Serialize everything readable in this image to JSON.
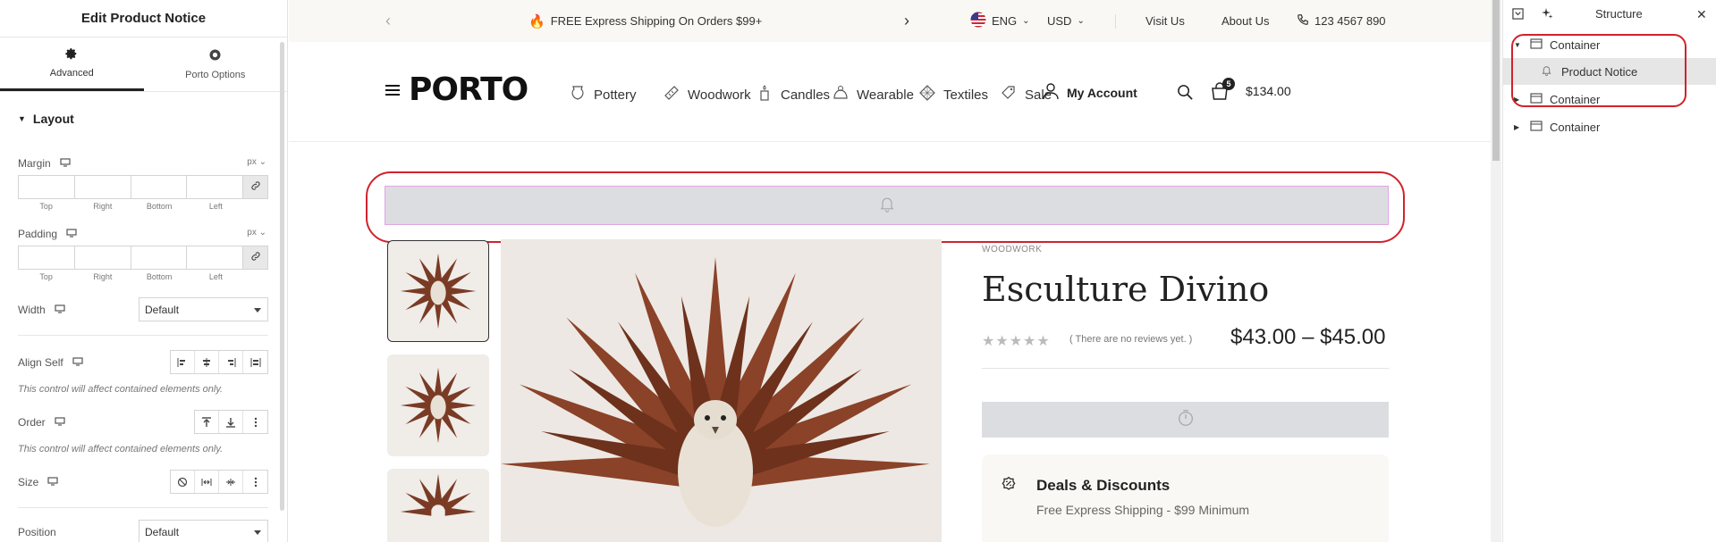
{
  "editor": {
    "title": "Edit Product Notice",
    "tabs": [
      {
        "label": "Advanced"
      },
      {
        "label": "Porto Options"
      }
    ],
    "section_title": "Layout",
    "margin": {
      "label": "Margin",
      "unit": "px",
      "sides": [
        "Top",
        "Right",
        "Bottom",
        "Left"
      ]
    },
    "padding": {
      "label": "Padding",
      "unit": "px",
      "sides": [
        "Top",
        "Right",
        "Bottom",
        "Left"
      ]
    },
    "width": {
      "label": "Width",
      "value": "Default"
    },
    "align_self": {
      "label": "Align Self",
      "note": "This control will affect contained elements only."
    },
    "order": {
      "label": "Order",
      "note": "This control will affect contained elements only."
    },
    "size": {
      "label": "Size"
    },
    "position": {
      "label": "Position",
      "value": "Default"
    }
  },
  "topbar": {
    "promo": "FREE Express Shipping On Orders $99+",
    "language": "ENG",
    "currency": "USD",
    "links": [
      "Visit Us",
      "About Us"
    ],
    "phone": "123 4567 890"
  },
  "header": {
    "logo": "PORTO",
    "nav": [
      "Pottery",
      "Woodwork",
      "Candles",
      "Wearable",
      "Textiles",
      "Sale"
    ],
    "account": "My Account",
    "cart_count": "5",
    "cart_total": "$134.00"
  },
  "product": {
    "category": "WOODWORK",
    "title": "Esculture Divino",
    "reviews": "( There are no reviews yet. )",
    "price": "$43.00 – $45.00",
    "deals_title": "Deals & Discounts",
    "deals_text": "Free Express Shipping - $99 Minimum"
  },
  "structure": {
    "title": "Structure",
    "items": [
      {
        "label": "Container"
      },
      {
        "label": "Product Notice"
      },
      {
        "label": "Container"
      },
      {
        "label": "Container"
      }
    ]
  },
  "colors": {
    "highlight_ring": "#d0232c",
    "accent": "#222222"
  }
}
